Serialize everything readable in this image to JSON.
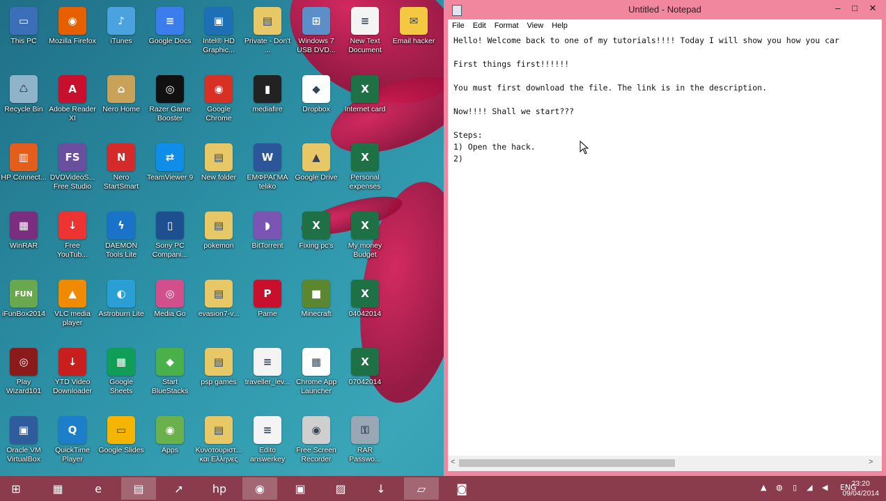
{
  "desktop": {
    "icons": [
      {
        "label": "This PC",
        "icon": "computer-icon",
        "color": "#3b6fb8",
        "glyph": "▭",
        "col": 0,
        "row": 0
      },
      {
        "label": "Mozilla Firefox",
        "icon": "firefox-icon",
        "color": "#e66000",
        "glyph": "◉",
        "col": 1,
        "row": 0
      },
      {
        "label": "iTunes",
        "icon": "itunes-icon",
        "color": "#4aa3df",
        "glyph": "♪",
        "col": 2,
        "row": 0
      },
      {
        "label": "Google Docs",
        "icon": "google-docs-icon",
        "color": "#3b7ded",
        "glyph": "≡",
        "col": 3,
        "row": 0
      },
      {
        "label": "Intel® HD Graphic...",
        "icon": "intel-graphics-icon",
        "color": "#1d6fb6",
        "glyph": "▣",
        "col": 4,
        "row": 0
      },
      {
        "label": "Private - Don't ...",
        "icon": "folder-icon",
        "color": "#e8c766",
        "glyph": "▤",
        "col": 5,
        "row": 0
      },
      {
        "label": "Windows 7 USB DVD...",
        "icon": "windows-usb-icon",
        "color": "#5c8fc9",
        "glyph": "⊞",
        "col": 6,
        "row": 0
      },
      {
        "label": "New Text Document",
        "icon": "text-document-icon",
        "color": "#f4f4f4",
        "glyph": "≡",
        "col": 7,
        "row": 0
      },
      {
        "label": "Email hacker",
        "icon": "email-icon",
        "color": "#f5c842",
        "glyph": "✉",
        "col": 8,
        "row": 0
      },
      {
        "label": "Recycle Bin",
        "icon": "recycle-bin-icon",
        "color": "#8fb3c8",
        "glyph": "♺",
        "col": 0,
        "row": 1
      },
      {
        "label": "Adobe Reader XI",
        "icon": "adobe-reader-icon",
        "color": "#c8102e",
        "glyph": "A",
        "col": 1,
        "row": 1
      },
      {
        "label": "Nero Home",
        "icon": "nero-home-icon",
        "color": "#c9a25a",
        "glyph": "⌂",
        "col": 2,
        "row": 1
      },
      {
        "label": "Razer Game Booster",
        "icon": "razer-icon",
        "color": "#111",
        "glyph": "◎",
        "col": 3,
        "row": 1
      },
      {
        "label": "Google Chrome",
        "icon": "chrome-icon",
        "color": "#d93025",
        "glyph": "◉",
        "col": 4,
        "row": 1
      },
      {
        "label": "mediafire",
        "icon": "mediafire-icon",
        "color": "#222",
        "glyph": "▮",
        "col": 5,
        "row": 1
      },
      {
        "label": "Dropbox",
        "icon": "dropbox-icon",
        "color": "#ffffff",
        "glyph": "◆",
        "col": 6,
        "row": 1
      },
      {
        "label": "Internet card",
        "icon": "excel-icon",
        "color": "#1e7145",
        "glyph": "X",
        "col": 7,
        "row": 1
      },
      {
        "label": "HP Connect...",
        "icon": "hp-connect-icon",
        "color": "#e35d1d",
        "glyph": "▥",
        "col": 0,
        "row": 2
      },
      {
        "label": "DVDVideoS... Free Studio",
        "icon": "dvdvideosoft-icon",
        "color": "#6a4fa0",
        "glyph": "FS",
        "col": 1,
        "row": 2
      },
      {
        "label": "Nero StartSmart",
        "icon": "nero-icon",
        "color": "#d42a2a",
        "glyph": "N",
        "col": 2,
        "row": 2
      },
      {
        "label": "TeamViewer 9",
        "icon": "teamviewer-icon",
        "color": "#0e8ee9",
        "glyph": "⇄",
        "col": 3,
        "row": 2
      },
      {
        "label": "New folder",
        "icon": "folder-icon",
        "color": "#e8c766",
        "glyph": "▤",
        "col": 4,
        "row": 2
      },
      {
        "label": "ΕΜΦΡΑΓΜΑ teliko",
        "icon": "word-icon",
        "color": "#2b579a",
        "glyph": "W",
        "col": 5,
        "row": 2
      },
      {
        "label": "Google Drive",
        "icon": "google-drive-icon",
        "color": "#e8c766",
        "glyph": "▲",
        "col": 6,
        "row": 2
      },
      {
        "label": "Personal expenses",
        "icon": "excel-icon",
        "color": "#1e7145",
        "glyph": "X",
        "col": 7,
        "row": 2
      },
      {
        "label": "WinRAR",
        "icon": "winrar-icon",
        "color": "#7b2d80",
        "glyph": "▦",
        "col": 0,
        "row": 3
      },
      {
        "label": "Free YouTub...",
        "icon": "free-youtube-icon",
        "color": "#e33",
        "glyph": "↓",
        "col": 1,
        "row": 3
      },
      {
        "label": "DAEMON Tools Lite",
        "icon": "daemon-tools-icon",
        "color": "#1a73c9",
        "glyph": "ϟ",
        "col": 2,
        "row": 3
      },
      {
        "label": "Sony PC Compani...",
        "icon": "sony-pc-icon",
        "color": "#1d4f91",
        "glyph": "▯",
        "col": 3,
        "row": 3
      },
      {
        "label": "pokemon",
        "icon": "folder-icon",
        "color": "#e8c766",
        "glyph": "▤",
        "col": 4,
        "row": 3
      },
      {
        "label": "BitTorrent",
        "icon": "bittorrent-icon",
        "color": "#7a55b3",
        "glyph": "◗",
        "col": 5,
        "row": 3
      },
      {
        "label": "Fixing pc's",
        "icon": "excel-icon",
        "color": "#1e7145",
        "glyph": "X",
        "col": 6,
        "row": 3
      },
      {
        "label": "My money Budget",
        "icon": "excel-icon",
        "color": "#1e7145",
        "glyph": "X",
        "col": 7,
        "row": 3
      },
      {
        "label": "iFunBox2014",
        "icon": "ifunbox-icon",
        "color": "#6aa84f",
        "glyph": "FUN",
        "col": 0,
        "row": 4
      },
      {
        "label": "VLC media player",
        "icon": "vlc-icon",
        "color": "#f08a00",
        "glyph": "▲",
        "col": 1,
        "row": 4
      },
      {
        "label": "Astroburn Lite",
        "icon": "astroburn-icon",
        "color": "#2a9fd6",
        "glyph": "◐",
        "col": 2,
        "row": 4
      },
      {
        "label": "Media Go",
        "icon": "media-go-icon",
        "color": "#d14f8a",
        "glyph": "◎",
        "col": 3,
        "row": 4
      },
      {
        "label": "evasion7-v...",
        "icon": "folder-icon",
        "color": "#e8c766",
        "glyph": "▤",
        "col": 4,
        "row": 4
      },
      {
        "label": "Pame",
        "icon": "pame-icon",
        "color": "#c8102e",
        "glyph": "P",
        "col": 5,
        "row": 4
      },
      {
        "label": "Minecraft",
        "icon": "minecraft-icon",
        "color": "#5b8731",
        "glyph": "■",
        "col": 6,
        "row": 4
      },
      {
        "label": "04042014",
        "icon": "excel-icon",
        "color": "#1e7145",
        "glyph": "X",
        "col": 7,
        "row": 4
      },
      {
        "label": "Play Wizard101",
        "icon": "wizard101-icon",
        "color": "#8b1a1a",
        "glyph": "◎",
        "col": 0,
        "row": 5
      },
      {
        "label": "YTD Video Downloader",
        "icon": "ytd-icon",
        "color": "#c81e1e",
        "glyph": "↓",
        "col": 1,
        "row": 5
      },
      {
        "label": "Google Sheets",
        "icon": "google-sheets-icon",
        "color": "#0f9d58",
        "glyph": "▦",
        "col": 2,
        "row": 5
      },
      {
        "label": "Start BlueStacks",
        "icon": "bluestacks-icon",
        "color": "#4ab04a",
        "glyph": "◆",
        "col": 3,
        "row": 5
      },
      {
        "label": "psp games",
        "icon": "folder-icon",
        "color": "#e8c766",
        "glyph": "▤",
        "col": 4,
        "row": 5
      },
      {
        "label": "traveller_lev...",
        "icon": "pdf-icon",
        "color": "#f4f4f4",
        "glyph": "≡",
        "col": 5,
        "row": 5
      },
      {
        "label": "Chrome App Launcher",
        "icon": "app-launcher-icon",
        "color": "#ffffff",
        "glyph": "▦",
        "col": 6,
        "row": 5
      },
      {
        "label": "07042014",
        "icon": "excel-icon",
        "color": "#1e7145",
        "glyph": "X",
        "col": 7,
        "row": 5
      },
      {
        "label": "Oracle VM VirtualBox",
        "icon": "virtualbox-icon",
        "color": "#2f5c9c",
        "glyph": "▣",
        "col": 0,
        "row": 6
      },
      {
        "label": "QuickTime Player",
        "icon": "quicktime-icon",
        "color": "#1d7ec9",
        "glyph": "Q",
        "col": 1,
        "row": 6
      },
      {
        "label": "Google Slides",
        "icon": "google-slides-icon",
        "color": "#f4b400",
        "glyph": "▭",
        "col": 2,
        "row": 6
      },
      {
        "label": "Apps",
        "icon": "apps-icon",
        "color": "#6ab04c",
        "glyph": "◉",
        "col": 3,
        "row": 6
      },
      {
        "label": "Κυνοτουριστ... και Ελληνες",
        "icon": "folder-icon",
        "color": "#e8c766",
        "glyph": "▤",
        "col": 4,
        "row": 6
      },
      {
        "label": "Edito answerkey",
        "icon": "pdf-icon",
        "color": "#f4f4f4",
        "glyph": "≡",
        "col": 5,
        "row": 6
      },
      {
        "label": "Free Screen Recorder",
        "icon": "screen-recorder-icon",
        "color": "#cfcfcf",
        "glyph": "◉",
        "col": 6,
        "row": 6
      },
      {
        "label": "RAR Passwo...",
        "icon": "rar-password-icon",
        "color": "#9aa7b5",
        "glyph": "⚿",
        "col": 7,
        "row": 6
      }
    ]
  },
  "notepad": {
    "title": "Untitled - Notepad",
    "menu": [
      "File",
      "Edit",
      "Format",
      "View",
      "Help"
    ],
    "text": "Hello! Welcome back to one of my tutorials!!!! Today I will show you how you car\n\nFirst things first!!!!!!\n\nYou must first download the file. The link is in the description.\n\nNow!!!! Shall we start???\n\nSteps:\n1) Open the hack.\n2)",
    "scroll_left": "<",
    "scroll_right": ">",
    "btn_minimize": "–",
    "btn_maximize": "□",
    "btn_close": "✕"
  },
  "taskbar": {
    "items": [
      {
        "name": "start-button",
        "glyph": "⊞",
        "active": false
      },
      {
        "name": "taskbar-apps",
        "glyph": "▦",
        "active": false
      },
      {
        "name": "taskbar-internet-explorer",
        "glyph": "e",
        "active": false
      },
      {
        "name": "taskbar-file-explorer",
        "glyph": "▤",
        "active": true
      },
      {
        "name": "taskbar-rocket",
        "glyph": "➚",
        "active": false
      },
      {
        "name": "taskbar-hp",
        "glyph": "hp",
        "active": false
      },
      {
        "name": "taskbar-chrome",
        "glyph": "◉",
        "active": true
      },
      {
        "name": "taskbar-remote",
        "glyph": "▣",
        "active": false
      },
      {
        "name": "taskbar-photos",
        "glyph": "▨",
        "active": false
      },
      {
        "name": "taskbar-downloader",
        "glyph": "↓",
        "active": false
      },
      {
        "name": "taskbar-notepad",
        "glyph": "▱",
        "active": true
      },
      {
        "name": "taskbar-camera",
        "glyph": "◙",
        "active": false
      }
    ],
    "language": "ENG",
    "time": "23:20",
    "date": "09/04/2014"
  }
}
